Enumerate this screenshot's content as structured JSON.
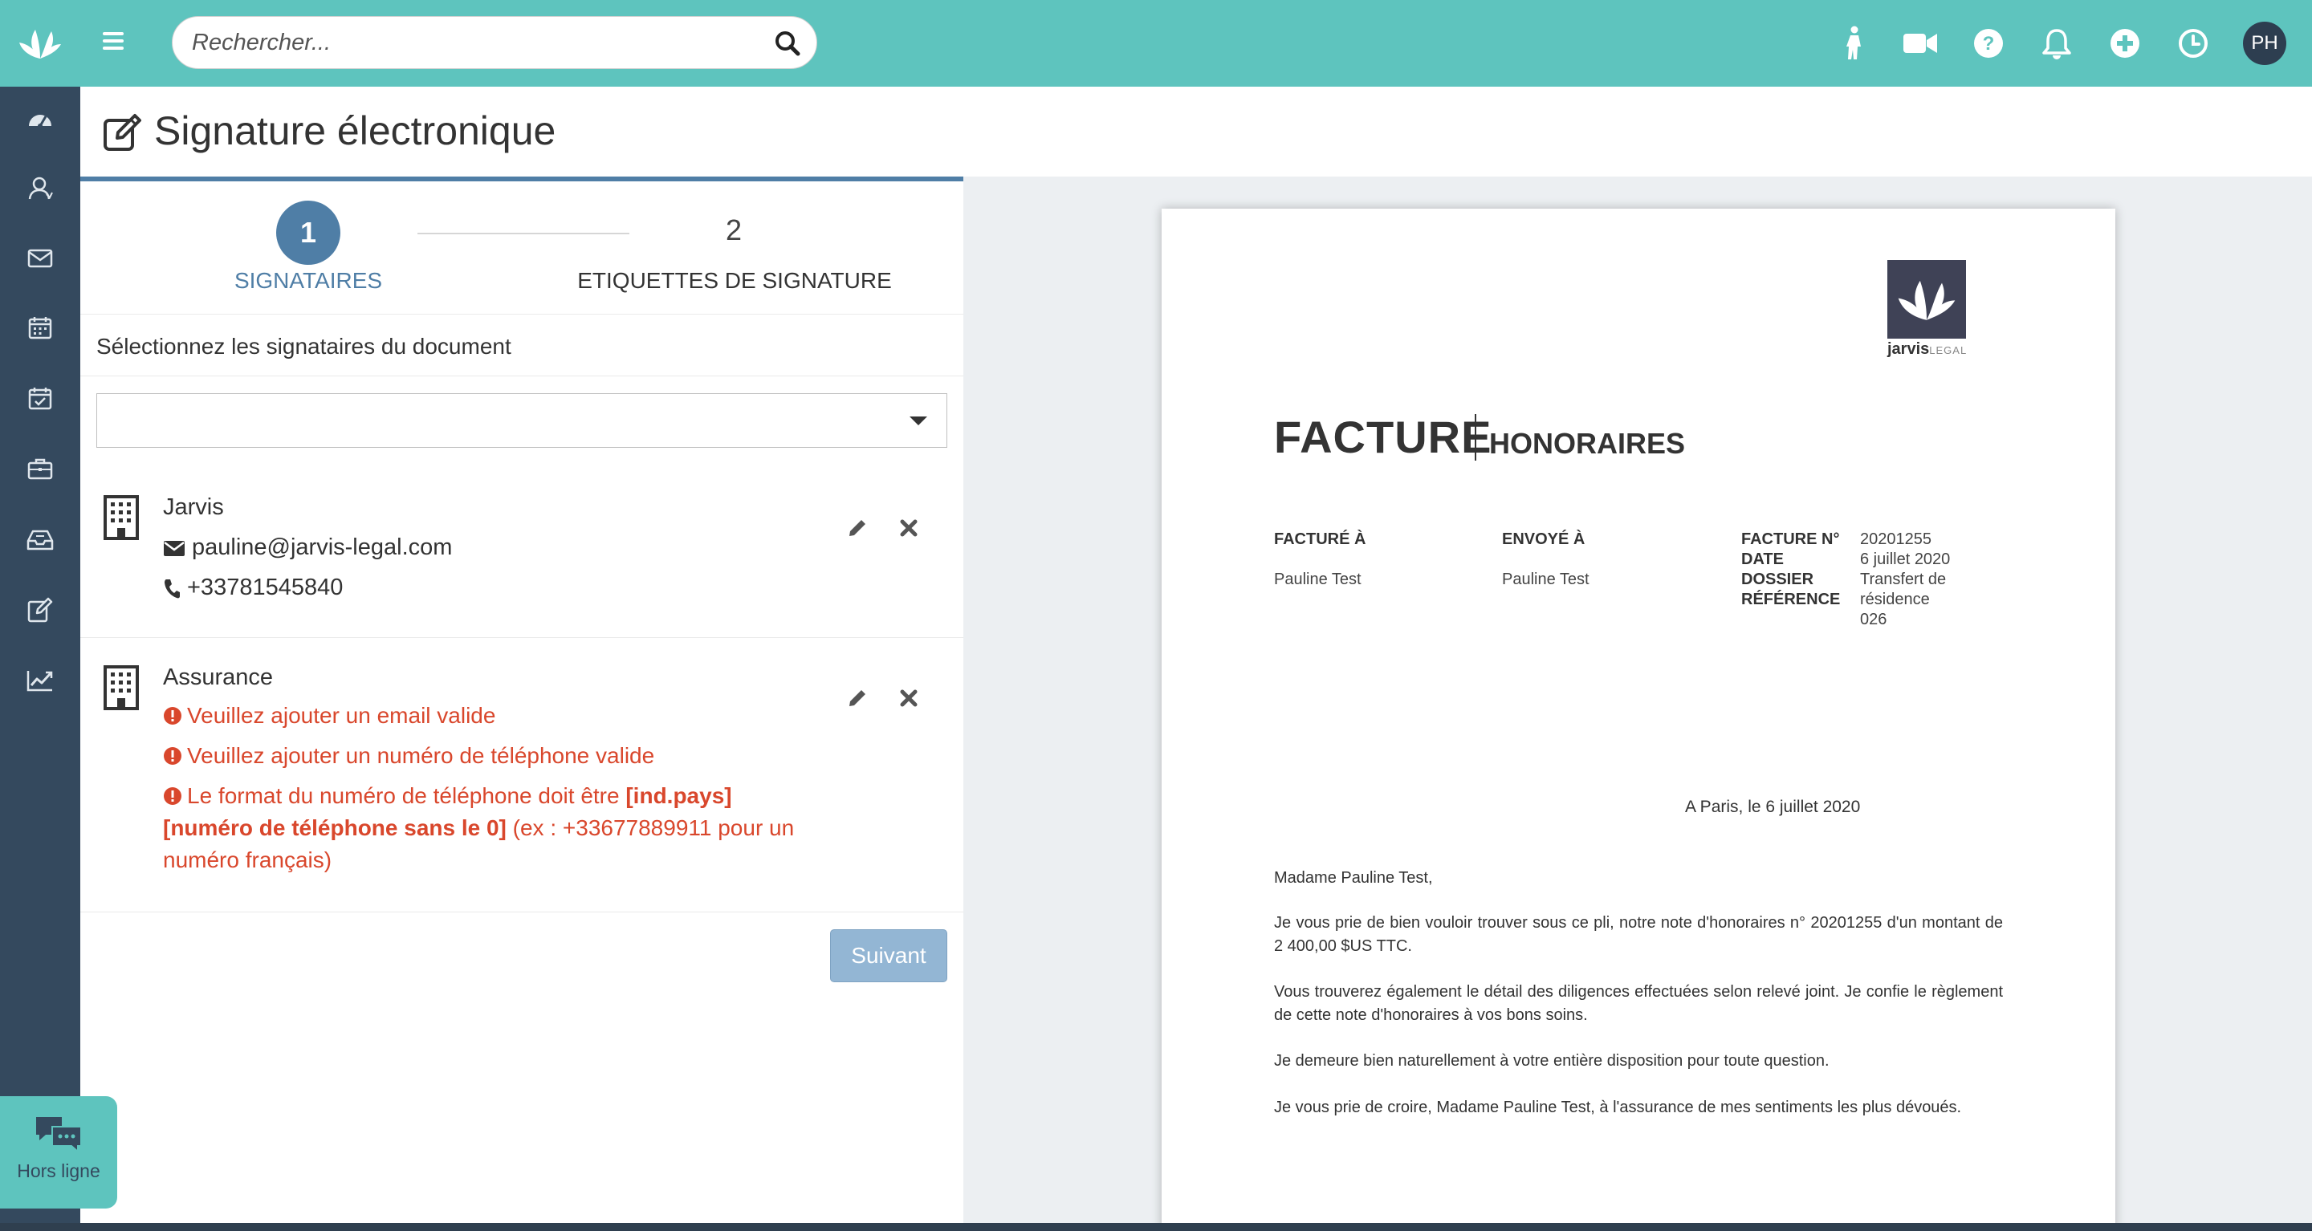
{
  "header": {
    "search_placeholder": "Rechercher...",
    "user_initials": "PH",
    "icons": [
      "person-walking-icon",
      "video-camera-icon",
      "help-icon",
      "bell-icon",
      "add-circle-icon",
      "clock-icon"
    ]
  },
  "sidebar": {
    "items": [
      "dashboard-icon",
      "contacts-icon",
      "mail-icon",
      "calendar-icon",
      "calendar-check-icon",
      "briefcase-icon",
      "inbox-icon",
      "edit-icon",
      "chart-icon"
    ]
  },
  "page": {
    "title": "Signature électronique"
  },
  "stepper": {
    "step1_number": "1",
    "step1_label": "SIGNATAIRES",
    "step2_number": "2",
    "step2_label": "ETIQUETTES DE SIGNATURE"
  },
  "form": {
    "instruction": "Sélectionnez les signataires du document",
    "select_value": ""
  },
  "signers": [
    {
      "name": "Jarvis",
      "email": "pauline@jarvis-legal.com",
      "phone": "+33781545840"
    },
    {
      "name": "Assurance",
      "errors": {
        "email": "Veuillez ajouter un email valide",
        "phone": "Veuillez ajouter un numéro de téléphone valide",
        "format_prefix": "Le format du numéro de téléphone doit être ",
        "format_bold": "[ind.pays] [numéro de téléphone sans le 0]",
        "format_suffix": " (ex : +33677889911 pour un numéro français)"
      }
    }
  ],
  "actions": {
    "next_label": "Suivant"
  },
  "document": {
    "brand_name": "jarvis",
    "brand_suffix": "LEGAL",
    "title": "FACTURE",
    "subtitle": "HONORAIRES",
    "billed_to_label": "FACTURÉ À",
    "billed_to_value": "Pauline Test",
    "sent_to_label": "ENVOYÉ À",
    "sent_to_value": "Pauline Test",
    "invoice_no_label": "FACTURE N°",
    "invoice_no_value": "20201255",
    "date_label": "DATE",
    "date_value": "6 juillet 2020",
    "case_label": "DOSSIER",
    "case_value": "Transfert de résidence",
    "ref_label": "RÉFÉRENCE",
    "ref_value": "026",
    "place_date": "A Paris, le 6 juillet 2020",
    "salutation": "Madame Pauline Test,",
    "paragraph1": "Je vous prie de bien vouloir trouver sous ce pli, notre note d'honoraires n° 20201255 d'un montant de 2 400,00 $US TTC.",
    "paragraph2": "Vous trouverez également le détail des diligences effectuées selon relevé joint. Je confie le règlement de cette note d'honoraires à vos bons soins.",
    "paragraph3": "Je demeure bien naturellement à votre entière disposition pour toute question.",
    "paragraph4": "Je vous prie de croire, Madame Pauline Test, à l'assurance de mes sentiments les plus dévoués."
  },
  "chat": {
    "status_label": "Hors ligne"
  },
  "colors": {
    "topbar": "#5ec4be",
    "sidebar": "#34495e",
    "accent": "#4f7ea6",
    "error": "#d9472c",
    "button": "#93b6d4"
  }
}
